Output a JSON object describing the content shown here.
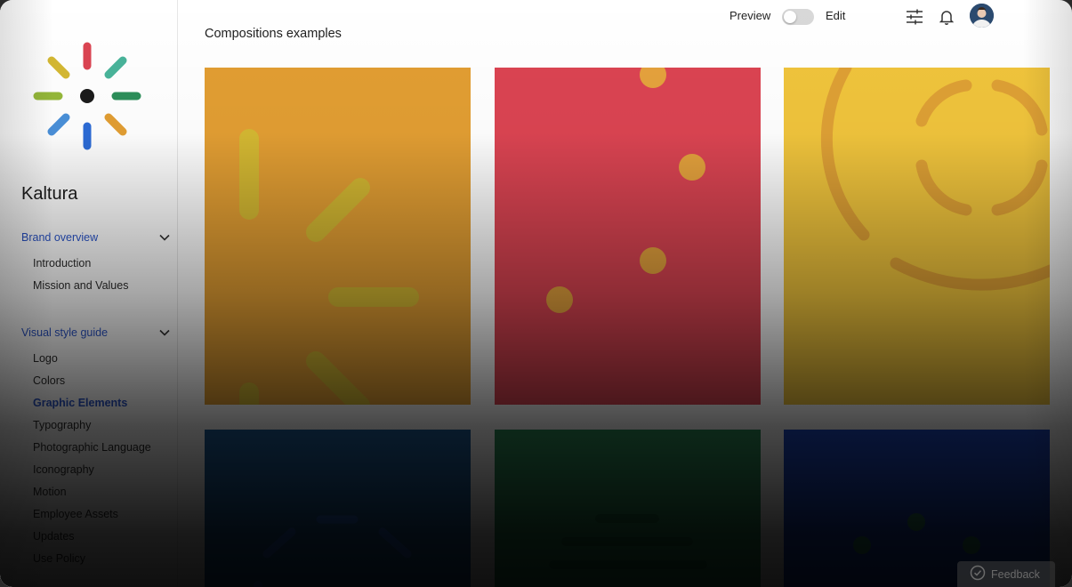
{
  "brand": {
    "name": "Kaltura"
  },
  "sidebar": {
    "sections": [
      {
        "label": "Brand overview",
        "items": [
          {
            "label": "Introduction"
          },
          {
            "label": "Mission and Values"
          }
        ]
      },
      {
        "label": "Visual style guide",
        "items": [
          {
            "label": "Logo"
          },
          {
            "label": "Colors"
          },
          {
            "label": "Graphic Elements",
            "active": true
          },
          {
            "label": "Typography"
          },
          {
            "label": "Photographic Language"
          },
          {
            "label": "Iconography"
          },
          {
            "label": "Motion"
          },
          {
            "label": "Employee Assets"
          },
          {
            "label": "Updates"
          },
          {
            "label": "Use Policy"
          }
        ]
      }
    ]
  },
  "topbar": {
    "mode_preview": "Preview",
    "mode_edit": "Edit",
    "icons": [
      "sliders-icon",
      "bell-icon",
      "avatar"
    ]
  },
  "main": {
    "title": "Compositions examples",
    "tiles": [
      {
        "color": "#E29E33"
      },
      {
        "color": "#DB4452"
      },
      {
        "color": "#F0C43C"
      },
      {
        "color": "#1E5E9A"
      },
      {
        "color": "#2D8F5A"
      },
      {
        "color": "#1D49C6"
      }
    ]
  },
  "feedback": {
    "label": "Feedback"
  },
  "colors": {
    "accent": "#2A54C9",
    "logo": [
      "#DB4452",
      "#2D8F5A",
      "#E29E33",
      "#2C6BD6",
      "#4A90D9",
      "#95B83A",
      "#D4B832",
      "#49B49A"
    ]
  }
}
